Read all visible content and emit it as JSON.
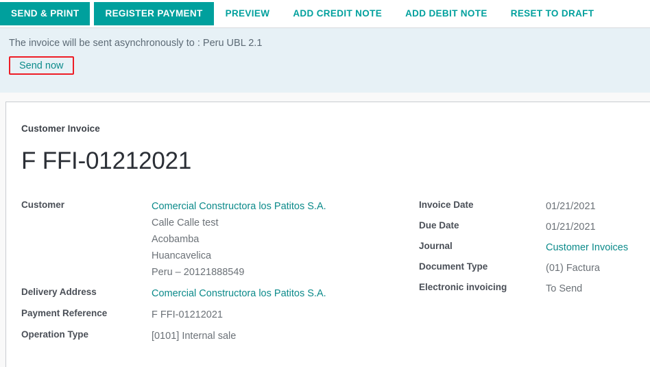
{
  "colors": {
    "accent": "#00a09d",
    "link": "#0b8a8a",
    "alert_bg": "#e7f1f6",
    "highlight_box": "#ee1c25",
    "label_text": "#4a4f57",
    "value_text": "#6b7177"
  },
  "statusbar": {
    "buttons": [
      {
        "label": "SEND & PRINT",
        "style": "primary"
      },
      {
        "label": "REGISTER PAYMENT",
        "style": "primary"
      },
      {
        "label": "PREVIEW",
        "style": "secondary"
      },
      {
        "label": "ADD CREDIT NOTE",
        "style": "secondary"
      },
      {
        "label": "ADD DEBIT NOTE",
        "style": "secondary"
      },
      {
        "label": "RESET TO DRAFT",
        "style": "secondary"
      }
    ]
  },
  "alert": {
    "message": "The invoice will be sent asynchronously to : Peru UBL 2.1",
    "send_now_label": "Send now",
    "highlighted": true
  },
  "sheet": {
    "subtitle": "Customer Invoice",
    "title": "F FFI-01212021",
    "left_fields": [
      {
        "label": "Customer",
        "lines": [
          {
            "text": "Comercial Constructora los Patitos S.A.",
            "link": true
          },
          {
            "text": "Calle Calle test",
            "link": false
          },
          {
            "text": "Acobamba",
            "link": false
          },
          {
            "text": "Huancavelica",
            "link": false
          },
          {
            "text": "Peru – 20121888549",
            "link": false
          }
        ]
      },
      {
        "label": "Delivery Address",
        "lines": [
          {
            "text": "Comercial Constructora los Patitos S.A.",
            "link": true
          }
        ]
      },
      {
        "label": "Payment Reference",
        "lines": [
          {
            "text": "F FFI-01212021",
            "link": false
          }
        ]
      },
      {
        "label": "Operation Type",
        "lines": [
          {
            "text": "[0101] Internal sale",
            "link": false
          }
        ]
      }
    ],
    "right_fields": [
      {
        "label": "Invoice Date",
        "value": "01/21/2021",
        "link": false
      },
      {
        "label": "Due Date",
        "value": "01/21/2021",
        "link": false
      },
      {
        "label": "Journal",
        "value": "Customer Invoices",
        "link": true
      },
      {
        "label": "Document Type",
        "value": "(01) Factura",
        "link": false
      },
      {
        "label": "Electronic invoicing",
        "value": "To Send",
        "link": false
      }
    ]
  }
}
